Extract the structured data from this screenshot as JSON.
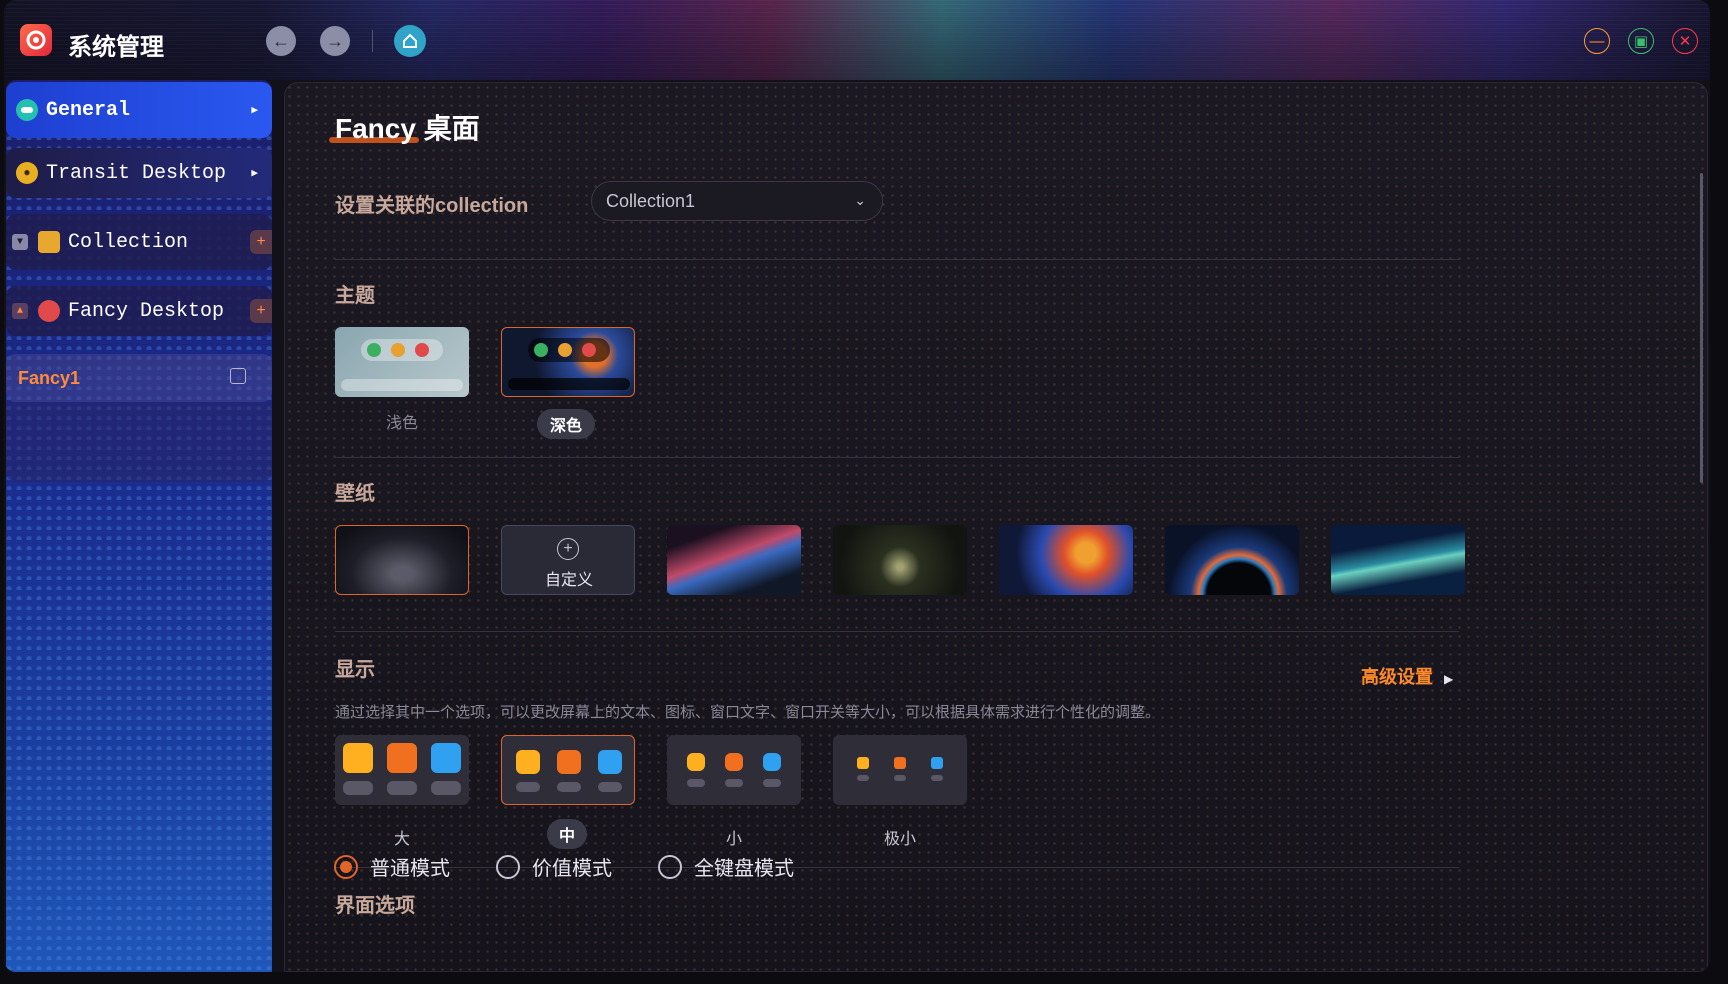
{
  "app": {
    "title": "系统管理",
    "accent": "#e0652a"
  },
  "toolbar": {
    "back_icon": "arrow-left-icon",
    "forward_icon": "arrow-right-icon",
    "home_icon": "home-icon",
    "minimize_icon": "minimize-icon",
    "maximize_icon": "maximize-icon",
    "close_icon": "close-icon"
  },
  "sidebar": {
    "items": [
      {
        "label": "General"
      },
      {
        "label": "Transit Desktop"
      },
      {
        "label": "Collection"
      },
      {
        "label": "Fancy Desktop"
      },
      {
        "label": "Fancy1"
      }
    ]
  },
  "main": {
    "title": "Fancy 桌面",
    "collection": {
      "label": "设置关联的collection",
      "value": "Collection1"
    },
    "theme": {
      "label": "主题",
      "options": [
        "浅色",
        "深色"
      ],
      "selected": "深色"
    },
    "wallpaper": {
      "label": "壁纸",
      "custom_label": "自定义"
    },
    "display": {
      "label": "显示",
      "advanced": "高级设置",
      "description": "通过选择其中一个选项，可以更改屏幕上的文本、图标、窗口文字、窗口开关等大小，可以根据具体需求进行个性化的调整。",
      "sizes": [
        "大",
        "中",
        "小",
        "极小"
      ],
      "selected": "中"
    },
    "interface": {
      "label": "界面选项",
      "modes": [
        "普通模式",
        "价值模式",
        "全键盘模式"
      ],
      "selected": "普通模式"
    }
  }
}
